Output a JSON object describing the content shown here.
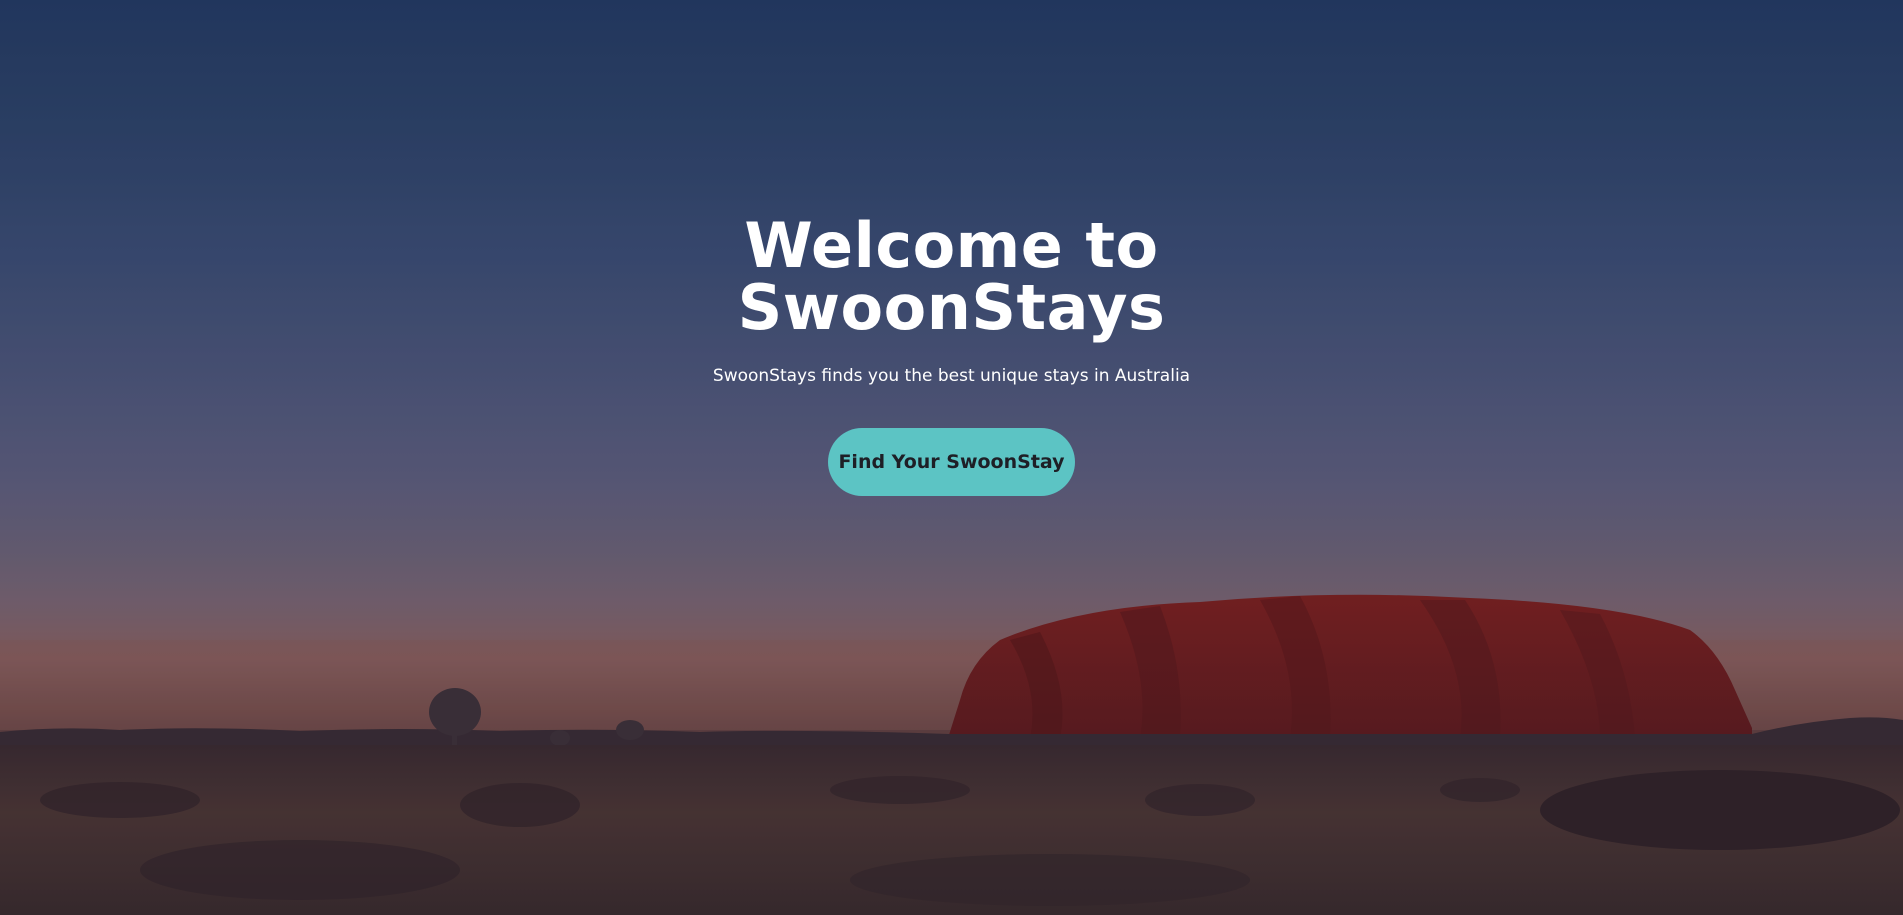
{
  "hero": {
    "title_line1": "Welcome to",
    "title_line2": "SwoonStays",
    "subtitle": "SwoonStays finds you the best unique stays in Australia",
    "cta_label": "Find Your SwoonStay"
  },
  "colors": {
    "cta_background": "#5cc4c4",
    "sky_top": "#233a62",
    "rock": "#7a1e1c"
  }
}
